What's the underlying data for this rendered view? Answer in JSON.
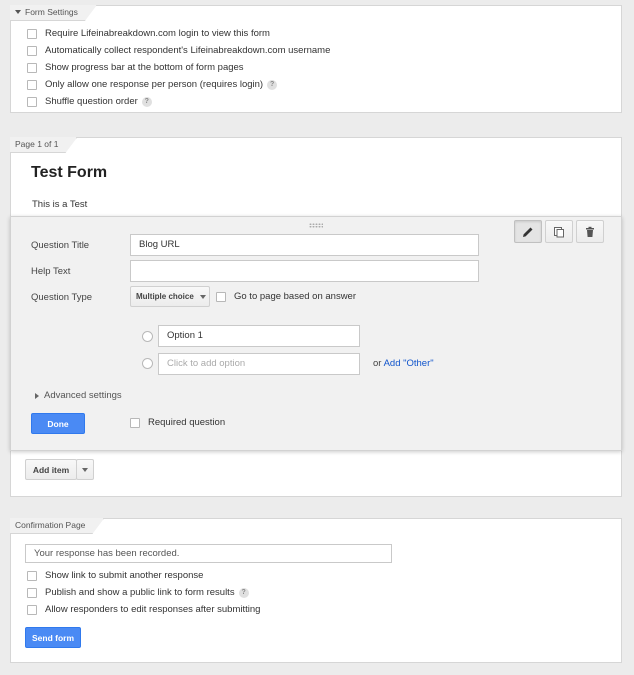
{
  "form_settings": {
    "tab_label": "Form Settings",
    "options": [
      {
        "label": "Require Lifeinabreakdown.com login to view this form",
        "help": false
      },
      {
        "label": "Automatically collect respondent's Lifeinabreakdown.com username",
        "help": false
      },
      {
        "label": "Show progress bar at the bottom of form pages",
        "help": false
      },
      {
        "label": "Only allow one response per person (requires login)",
        "help": true
      },
      {
        "label": "Shuffle question order",
        "help": true
      }
    ]
  },
  "page": {
    "tab_label": "Page 1 of 1",
    "title": "Test Form",
    "description": "This is a Test"
  },
  "question": {
    "title_label": "Question Title",
    "title_value": "Blog URL",
    "help_label": "Help Text",
    "help_value": "",
    "type_label": "Question Type",
    "type_value": "Multiple choice",
    "go_to_page_label": "Go to page based on answer",
    "option_1": "Option 1",
    "add_option_placeholder": "Click to add option",
    "or_text": "or",
    "add_other_label": "Add \"Other\"",
    "advanced_label": "Advanced settings",
    "done_label": "Done",
    "required_label": "Required question"
  },
  "add_item": {
    "label": "Add item"
  },
  "confirmation": {
    "tab_label": "Confirmation Page",
    "message": "Your response has been recorded.",
    "options": [
      {
        "label": "Show link to submit another response",
        "help": false
      },
      {
        "label": "Publish and show a public link to form results",
        "help": true
      },
      {
        "label": "Allow responders to edit responses after submitting",
        "help": false
      }
    ],
    "send_label": "Send form"
  },
  "help_glyph": "?",
  "colors": {
    "accent_blue": "#4a8af4",
    "link_blue": "#1155cc",
    "background": "#ececec"
  }
}
